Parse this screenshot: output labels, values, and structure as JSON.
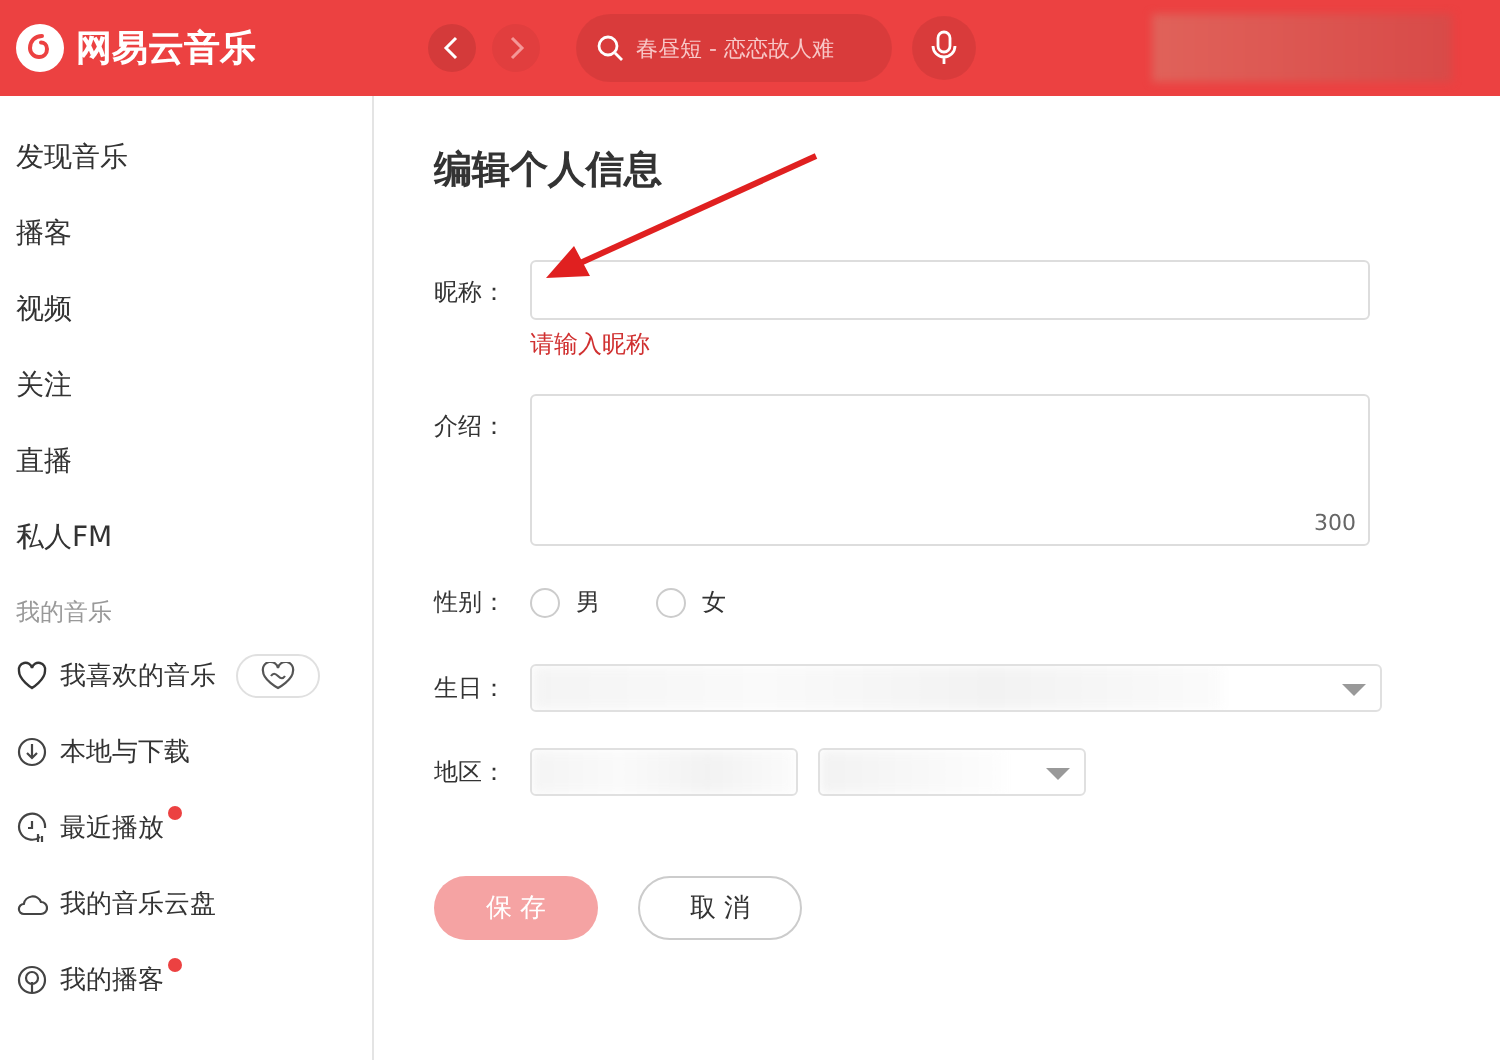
{
  "header": {
    "app_name": "网易云音乐",
    "back_enabled": true,
    "forward_enabled": false,
    "search": {
      "placeholder": "春昼短 - 恋恋故人难"
    }
  },
  "sidebar": {
    "items": [
      {
        "label": "发现音乐",
        "selected": false
      },
      {
        "label": "播客",
        "selected": false
      },
      {
        "label": "视频",
        "selected": false
      },
      {
        "label": "关注",
        "selected": false
      },
      {
        "label": "直播",
        "selected": false
      },
      {
        "label": "私人FM",
        "selected": false
      }
    ],
    "section_title": "我的音乐",
    "my_music": [
      {
        "kind": "heart",
        "label": "我喜欢的音乐",
        "badge": false,
        "heartbeat_button": true
      },
      {
        "kind": "download",
        "label": "本地与下载",
        "badge": false,
        "heartbeat_button": false
      },
      {
        "kind": "recent",
        "label": "最近播放",
        "badge": true,
        "heartbeat_button": false
      },
      {
        "kind": "cloud",
        "label": "我的音乐云盘",
        "badge": false,
        "heartbeat_button": false
      },
      {
        "kind": "podcast",
        "label": "我的播客",
        "badge": true,
        "heartbeat_button": false
      }
    ]
  },
  "form": {
    "title": "编辑个人信息",
    "nickname": {
      "label": "昵称：",
      "error": "请输入昵称"
    },
    "intro": {
      "label": "介绍：",
      "counter": "300"
    },
    "gender": {
      "label": "性别：",
      "options": [
        {
          "label": "男",
          "selected": false
        },
        {
          "label": "女",
          "selected": false
        }
      ]
    },
    "birthday": {
      "label": "生日："
    },
    "region": {
      "label": "地区："
    },
    "buttons": [
      {
        "kind": "primary",
        "label": "保 存"
      },
      {
        "kind": "secondary",
        "label": "取 消"
      }
    ]
  }
}
